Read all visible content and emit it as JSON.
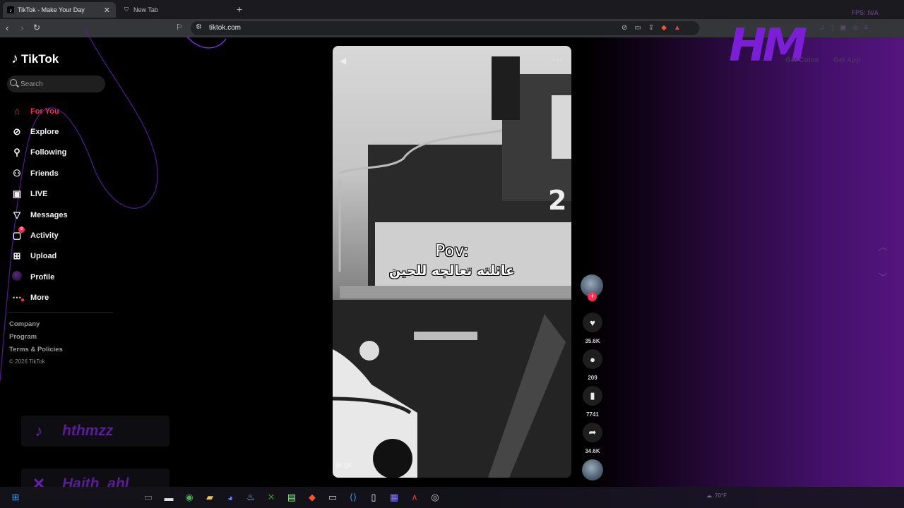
{
  "browser": {
    "tabs": [
      {
        "title": "TikTok - Make Your Day",
        "active": true
      },
      {
        "title": "New Tab",
        "active": false
      }
    ],
    "new_tab_glyph": "+",
    "close_glyph": "✕",
    "url": "tiktok.com",
    "fps_overlay": "FPS: N/A"
  },
  "sidebar": {
    "logo_text": "TikTok",
    "search_placeholder": "Search",
    "items": [
      {
        "label": "For You",
        "icon": "home-icon",
        "active": true
      },
      {
        "label": "Explore",
        "icon": "compass-icon"
      },
      {
        "label": "Following",
        "icon": "following-icon"
      },
      {
        "label": "Friends",
        "icon": "friends-icon"
      },
      {
        "label": "LIVE",
        "icon": "live-icon"
      },
      {
        "label": "Messages",
        "icon": "messages-icon"
      },
      {
        "label": "Activity",
        "icon": "activity-icon",
        "badge": "9"
      },
      {
        "label": "Upload",
        "icon": "upload-icon"
      },
      {
        "label": "Profile",
        "icon": "avatar"
      },
      {
        "label": "More",
        "icon": "more-icon"
      }
    ],
    "footer_links": [
      "Company",
      "Program",
      "Terms & Policies"
    ],
    "copyright": "© 2026 TikTok"
  },
  "header_right": {
    "coins_label": "Get Coins",
    "get_app_label": "Get App"
  },
  "video": {
    "caption_line1": "Pov:",
    "caption_line2": "عائلته تعالجه للحين",
    "watermark": "je.gc",
    "locomotive_number": "2"
  },
  "actions": {
    "likes": "35.6K",
    "comments": "209",
    "saves": "7741",
    "shares": "34.6K"
  },
  "overlays": {
    "tiktok_handle": "hthmzz",
    "x_handle": "Haith_ahl",
    "stream_logo": "HM"
  },
  "taskbar": {
    "weather": "70°F"
  },
  "colors": {
    "accent": "#fe2c55",
    "overlay_purple": "#7a1fd6"
  }
}
